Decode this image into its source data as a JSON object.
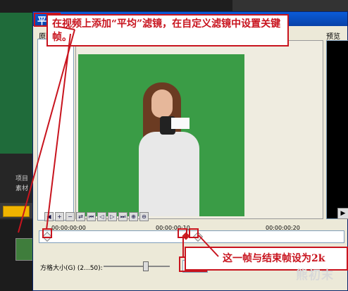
{
  "background_editor": {
    "tab_project": "项目",
    "tab_material": "素材"
  },
  "dialog": {
    "title": "平均",
    "original_label": "原图",
    "preview_label": "预览",
    "timeline": {
      "times": [
        "00:00:00:00",
        "00:00:00:10",
        "00:00:00:20"
      ]
    },
    "toolbar_icons": [
      "back-icon",
      "add-keyframe-icon",
      "remove-keyframe-icon",
      "reverse-icon",
      "first-key-icon",
      "prev-key-icon",
      "next-key-icon",
      "last-key-icon",
      "zoom-in-icon",
      "zoom-out-icon"
    ],
    "grid_size": {
      "label": "方格大小(G)",
      "range": "(2...50):",
      "value": "30"
    }
  },
  "annotations": {
    "top_note": "在视频上添加“平均”滤镜，在自定义滤镜中设置关键帧。",
    "bottom_note": "这一帧与结束帧设为2k"
  },
  "watermark": "熊初末",
  "colors": {
    "annotation_red": "#c8141e",
    "titlebar_blue": "#0a5bd8",
    "chroma_green": "#3a9c46"
  }
}
